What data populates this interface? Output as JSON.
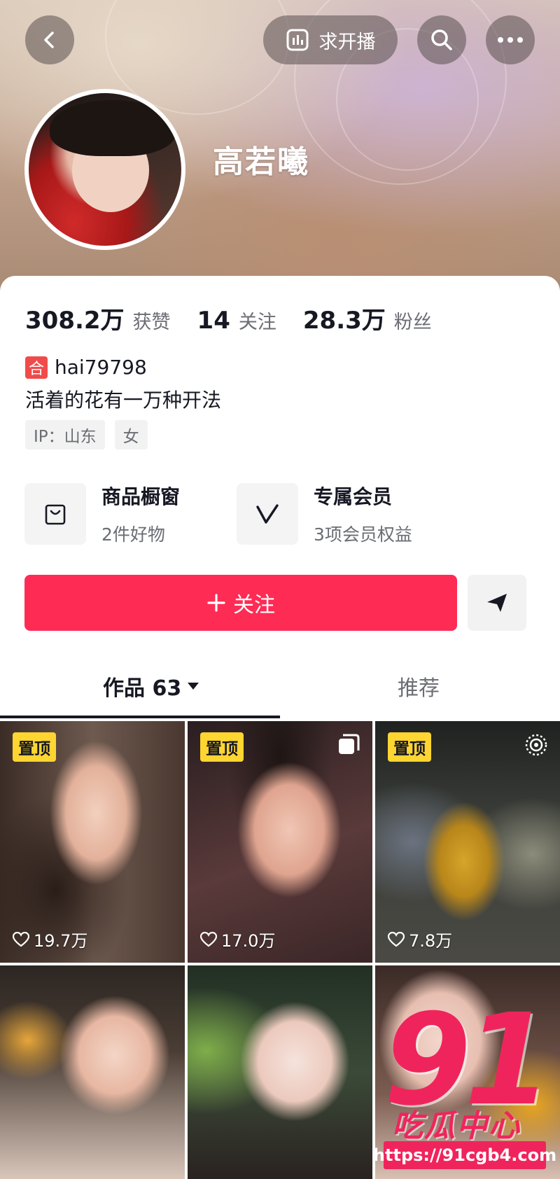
{
  "header": {
    "live_request_label": "求开播",
    "name": "高若曦"
  },
  "stats": [
    {
      "value": "308.2万",
      "label": "获赞"
    },
    {
      "value": "14",
      "label": "关注"
    },
    {
      "value": "28.3万",
      "label": "粉丝"
    }
  ],
  "profile": {
    "badge": "合",
    "handle": "hai79798",
    "bio": "活着的花有一万种开法",
    "tags": [
      "IP：山东",
      "女"
    ]
  },
  "services": [
    {
      "title": "商品橱窗",
      "subtitle": "2件好物",
      "icon": "shopping-bag-icon"
    },
    {
      "title": "专属会员",
      "subtitle": "3项会员权益",
      "icon": "vip-v-icon"
    }
  ],
  "actions": {
    "follow_label": "关注"
  },
  "tabs": {
    "works_label": "作品 63",
    "recommend_label": "推荐"
  },
  "videos": [
    {
      "pinned": "置顶",
      "likes": "19.7万"
    },
    {
      "pinned": "置顶",
      "likes": "17.0万"
    },
    {
      "pinned": "置顶",
      "likes": "7.8万"
    },
    {
      "pinned": "",
      "likes": ""
    },
    {
      "pinned": "",
      "likes": ""
    },
    {
      "pinned": "",
      "likes": ""
    }
  ],
  "watermark": {
    "number": "91",
    "text": "吃瓜中心",
    "url": "https://91cgb4.com"
  },
  "colors": {
    "accent": "#fe2c55",
    "pin_badge": "#ffd531",
    "watermark": "#f0245c"
  }
}
